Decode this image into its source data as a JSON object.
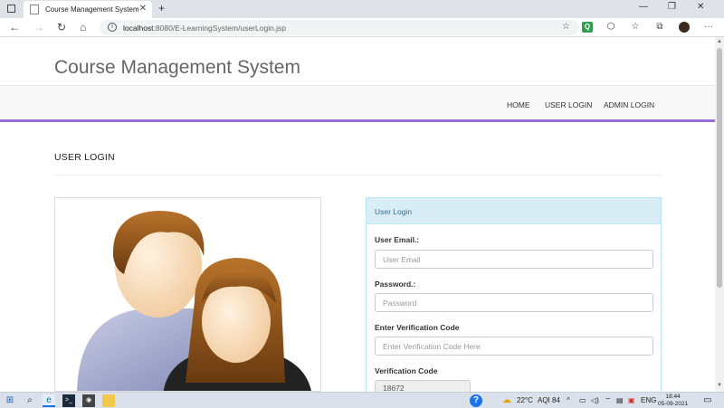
{
  "browser": {
    "tab_title": "Course Management System",
    "tab_close": "✕",
    "new_tab": "+",
    "url_host": "localhost",
    "url_rest": ":8080/E-LearningSystem/userLogin.jsp",
    "win_min": "—",
    "win_restore": "❐",
    "win_close": "✕"
  },
  "header": {
    "site_title": "Course Management System"
  },
  "nav": {
    "items": [
      {
        "label": "HOME"
      },
      {
        "label": "USER LOGIN"
      },
      {
        "label": "ADMIN LOGIN"
      }
    ]
  },
  "main": {
    "section_title": "USER LOGIN",
    "panel": {
      "heading": "User Login",
      "email_label": "User Email.:",
      "email_placeholder": "User Email",
      "password_label": "Password.:",
      "password_placeholder": "Password",
      "code_label": "Enter Verification Code",
      "code_placeholder": "Enter Verification Code Here",
      "verification_label": "Verification Code",
      "verification_value": "18672"
    }
  },
  "taskbar": {
    "temperature": "22°C",
    "aqi": "AQI 84",
    "language": "ENG",
    "time": "18:44",
    "date": "05-09-2021"
  },
  "icons": {
    "back": "←",
    "forward": "→",
    "refresh": "↻",
    "home": "⌂",
    "star": "☆",
    "more": "···",
    "windows": "⊞",
    "search": "⌕"
  }
}
